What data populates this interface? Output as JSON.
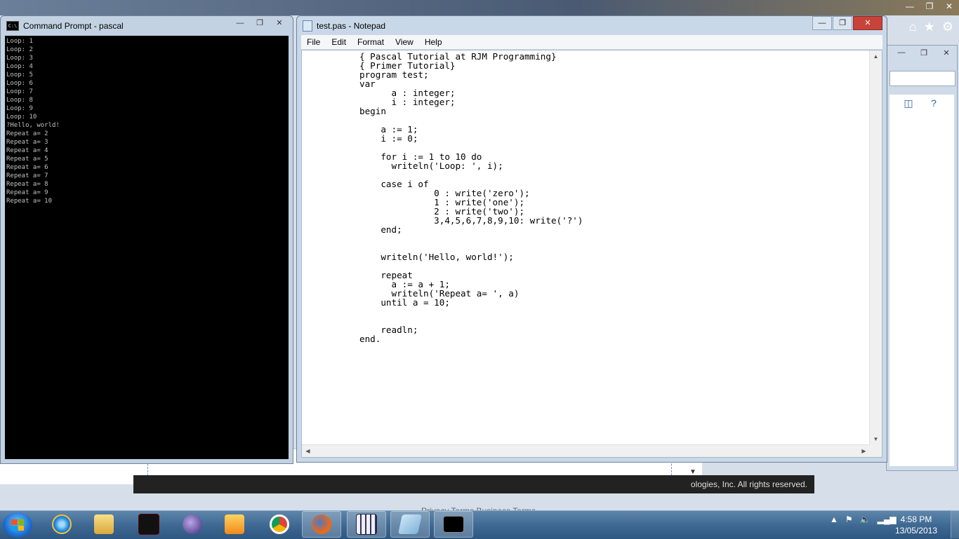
{
  "cmd": {
    "title": "Command Prompt - pascal",
    "icon_label": "C:\\",
    "output": [
      "Loop: 1",
      "Loop: 2",
      "Loop: 3",
      "Loop: 4",
      "Loop: 5",
      "Loop: 6",
      "Loop: 7",
      "Loop: 8",
      "Loop: 9",
      "Loop: 10",
      "?Hello, world!",
      "Repeat a= 2",
      "Repeat a= 3",
      "Repeat a= 4",
      "Repeat a= 5",
      "Repeat a= 6",
      "Repeat a= 7",
      "Repeat a= 8",
      "Repeat a= 9",
      "Repeat a= 10"
    ]
  },
  "notepad": {
    "title": "test.pas - Notepad",
    "menu": [
      "File",
      "Edit",
      "Format",
      "View",
      "Help"
    ],
    "code": "{ Pascal Tutorial at RJM Programming}\n{ Primer Tutorial}\nprogram test;\nvar\n      a : integer;\n      i : integer;\nbegin\n\n    a := 1;\n    i := 0;\n\n    for i := 1 to 10 do\n      writeln('Loop: ', i);\n\n    case i of\n              0 : write('zero');\n              1 : write('one');\n              2 : write('two');\n              3,4,5,6,7,8,9,10: write('?')\n    end;\n\n\n    writeln('Hello, world!');\n\n    repeat\n      a := a + 1;\n      writeln('Repeat a= ', a)\n    until a = 10;\n\n\n    readln;\nend."
  },
  "browser": {
    "copyright": "ologies, Inc. All rights reserved.",
    "footer_links": "Privacy Terms   Business Terms"
  },
  "taskbar": {
    "time": "4:58 PM",
    "date": "13/05/2013",
    "apps": [
      "ie-icon",
      "explorer-icon",
      "terminal-black-icon",
      "eclipse-icon",
      "media-icon",
      "chrome-icon",
      "firefox-icon",
      "calculator-icon",
      "notepad-icon",
      "cmd-icon"
    ]
  }
}
